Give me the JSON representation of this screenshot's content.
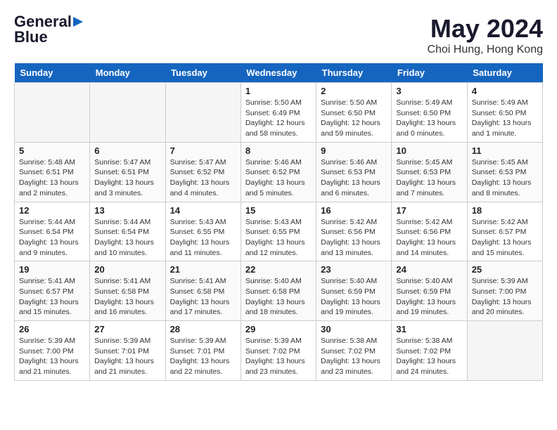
{
  "header": {
    "logo_line1": "General",
    "logo_line2": "Blue",
    "month_title": "May 2024",
    "location": "Choi Hung, Hong Kong"
  },
  "days_of_week": [
    "Sunday",
    "Monday",
    "Tuesday",
    "Wednesday",
    "Thursday",
    "Friday",
    "Saturday"
  ],
  "weeks": [
    [
      {
        "day": "",
        "empty": true
      },
      {
        "day": "",
        "empty": true
      },
      {
        "day": "",
        "empty": true
      },
      {
        "day": "1",
        "sunrise": "5:50 AM",
        "sunset": "6:49 PM",
        "daylight": "12 hours and 58 minutes."
      },
      {
        "day": "2",
        "sunrise": "5:50 AM",
        "sunset": "6:50 PM",
        "daylight": "12 hours and 59 minutes."
      },
      {
        "day": "3",
        "sunrise": "5:49 AM",
        "sunset": "6:50 PM",
        "daylight": "13 hours and 0 minutes."
      },
      {
        "day": "4",
        "sunrise": "5:49 AM",
        "sunset": "6:50 PM",
        "daylight": "13 hours and 1 minute."
      }
    ],
    [
      {
        "day": "5",
        "sunrise": "5:48 AM",
        "sunset": "6:51 PM",
        "daylight": "13 hours and 2 minutes."
      },
      {
        "day": "6",
        "sunrise": "5:47 AM",
        "sunset": "6:51 PM",
        "daylight": "13 hours and 3 minutes."
      },
      {
        "day": "7",
        "sunrise": "5:47 AM",
        "sunset": "6:52 PM",
        "daylight": "13 hours and 4 minutes."
      },
      {
        "day": "8",
        "sunrise": "5:46 AM",
        "sunset": "6:52 PM",
        "daylight": "13 hours and 5 minutes."
      },
      {
        "day": "9",
        "sunrise": "5:46 AM",
        "sunset": "6:53 PM",
        "daylight": "13 hours and 6 minutes."
      },
      {
        "day": "10",
        "sunrise": "5:45 AM",
        "sunset": "6:53 PM",
        "daylight": "13 hours and 7 minutes."
      },
      {
        "day": "11",
        "sunrise": "5:45 AM",
        "sunset": "6:53 PM",
        "daylight": "13 hours and 8 minutes."
      }
    ],
    [
      {
        "day": "12",
        "sunrise": "5:44 AM",
        "sunset": "6:54 PM",
        "daylight": "13 hours and 9 minutes."
      },
      {
        "day": "13",
        "sunrise": "5:44 AM",
        "sunset": "6:54 PM",
        "daylight": "13 hours and 10 minutes."
      },
      {
        "day": "14",
        "sunrise": "5:43 AM",
        "sunset": "6:55 PM",
        "daylight": "13 hours and 11 minutes."
      },
      {
        "day": "15",
        "sunrise": "5:43 AM",
        "sunset": "6:55 PM",
        "daylight": "13 hours and 12 minutes."
      },
      {
        "day": "16",
        "sunrise": "5:42 AM",
        "sunset": "6:56 PM",
        "daylight": "13 hours and 13 minutes."
      },
      {
        "day": "17",
        "sunrise": "5:42 AM",
        "sunset": "6:56 PM",
        "daylight": "13 hours and 14 minutes."
      },
      {
        "day": "18",
        "sunrise": "5:42 AM",
        "sunset": "6:57 PM",
        "daylight": "13 hours and 15 minutes."
      }
    ],
    [
      {
        "day": "19",
        "sunrise": "5:41 AM",
        "sunset": "6:57 PM",
        "daylight": "13 hours and 15 minutes."
      },
      {
        "day": "20",
        "sunrise": "5:41 AM",
        "sunset": "6:58 PM",
        "daylight": "13 hours and 16 minutes."
      },
      {
        "day": "21",
        "sunrise": "5:41 AM",
        "sunset": "6:58 PM",
        "daylight": "13 hours and 17 minutes."
      },
      {
        "day": "22",
        "sunrise": "5:40 AM",
        "sunset": "6:58 PM",
        "daylight": "13 hours and 18 minutes."
      },
      {
        "day": "23",
        "sunrise": "5:40 AM",
        "sunset": "6:59 PM",
        "daylight": "13 hours and 19 minutes."
      },
      {
        "day": "24",
        "sunrise": "5:40 AM",
        "sunset": "6:59 PM",
        "daylight": "13 hours and 19 minutes."
      },
      {
        "day": "25",
        "sunrise": "5:39 AM",
        "sunset": "7:00 PM",
        "daylight": "13 hours and 20 minutes."
      }
    ],
    [
      {
        "day": "26",
        "sunrise": "5:39 AM",
        "sunset": "7:00 PM",
        "daylight": "13 hours and 21 minutes."
      },
      {
        "day": "27",
        "sunrise": "5:39 AM",
        "sunset": "7:01 PM",
        "daylight": "13 hours and 21 minutes."
      },
      {
        "day": "28",
        "sunrise": "5:39 AM",
        "sunset": "7:01 PM",
        "daylight": "13 hours and 22 minutes."
      },
      {
        "day": "29",
        "sunrise": "5:39 AM",
        "sunset": "7:02 PM",
        "daylight": "13 hours and 23 minutes."
      },
      {
        "day": "30",
        "sunrise": "5:38 AM",
        "sunset": "7:02 PM",
        "daylight": "13 hours and 23 minutes."
      },
      {
        "day": "31",
        "sunrise": "5:38 AM",
        "sunset": "7:02 PM",
        "daylight": "13 hours and 24 minutes."
      },
      {
        "day": "",
        "empty": true
      }
    ]
  ]
}
